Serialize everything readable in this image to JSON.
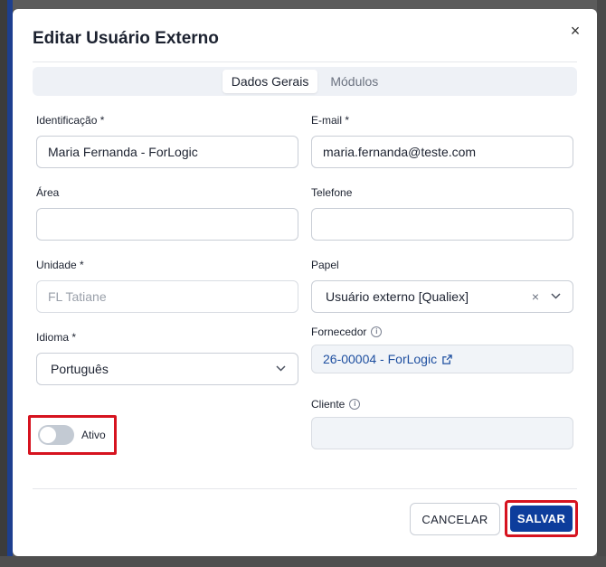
{
  "modal": {
    "title": "Editar Usuário Externo",
    "close_glyph": "×"
  },
  "tabs": [
    {
      "label": "Dados Gerais",
      "active": true
    },
    {
      "label": "Módulos",
      "active": false
    }
  ],
  "fields": {
    "identificacao": {
      "label": "Identificação *",
      "value": "Maria Fernanda - ForLogic"
    },
    "email": {
      "label": "E-mail *",
      "value": "maria.fernanda@teste.com"
    },
    "area": {
      "label": "Área",
      "value": ""
    },
    "telefone": {
      "label": "Telefone",
      "value": ""
    },
    "unidade": {
      "label": "Unidade *",
      "placeholder": "FL Tatiane"
    },
    "papel": {
      "label": "Papel",
      "value": "Usuário externo [Qualiex]"
    },
    "idioma": {
      "label": "Idioma *",
      "value": "Português"
    },
    "fornecedor": {
      "label": "Fornecedor",
      "value": "26-00004 - ForLogic"
    },
    "cliente": {
      "label": "Cliente",
      "value": ""
    }
  },
  "toggle": {
    "label": "Ativo",
    "state": "off"
  },
  "footer": {
    "cancel_label": "CANCELAR",
    "save_label": "SALVAR"
  },
  "colors": {
    "primary": "#0d3d9c",
    "highlight": "#d6131f",
    "link": "#1e4fa0"
  },
  "icons": {
    "close": "close-icon",
    "chevron": "chevron-down-icon",
    "clear": "clear-icon",
    "info": "info-icon",
    "external_link": "external-link-icon"
  }
}
